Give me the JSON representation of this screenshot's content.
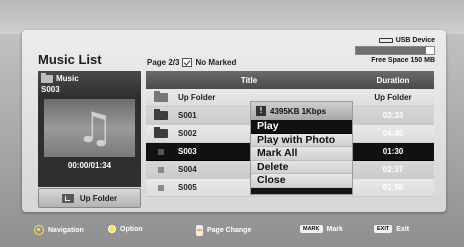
{
  "header": {
    "title": "Music List",
    "page_info": "Page 2/3",
    "no_marked": "No Marked"
  },
  "usb": {
    "label": "USB Device",
    "free_space": "Free Space 150 MB",
    "usage_fraction": 0.9
  },
  "now_playing": {
    "folder_label": "Music",
    "track": "S003",
    "time": "00:00/01:34",
    "icon": "music-note-icon"
  },
  "up_folder_button": "Up Folder",
  "columns": {
    "title": "Title",
    "duration": "Duration"
  },
  "rows": [
    {
      "name": "Up Folder",
      "duration": "Up Folder",
      "icon": "up-folder-icon",
      "type": "upfolder"
    },
    {
      "name": "S001",
      "duration": "03:33",
      "icon": "folder-icon",
      "type": "folder"
    },
    {
      "name": "S002",
      "duration": "04:45",
      "icon": "folder-icon",
      "type": "folder"
    },
    {
      "name": "S003",
      "duration": "01:30",
      "icon": "file-icon",
      "type": "file",
      "selected": true
    },
    {
      "name": "S004",
      "duration": "02:37",
      "icon": "file-icon",
      "type": "file"
    },
    {
      "name": "S005",
      "duration": "01:58",
      "icon": "file-icon",
      "type": "file"
    }
  ],
  "popup": {
    "info": "4395KB 1Kbps",
    "items": [
      "Play",
      "Play with Photo",
      "Mark All",
      "Delete",
      "Close"
    ],
    "active_index": 0
  },
  "footer": {
    "navigation": "Navigation",
    "option": "Option",
    "page_change": "Page Change",
    "mark_key": "MARK",
    "mark": "Mark",
    "exit_key": "EXIT",
    "exit": "Exit"
  },
  "colors": {
    "accent_yellow": "#ffe14d",
    "selected_row": "#111111",
    "header_dark": "#4b4b4b"
  }
}
